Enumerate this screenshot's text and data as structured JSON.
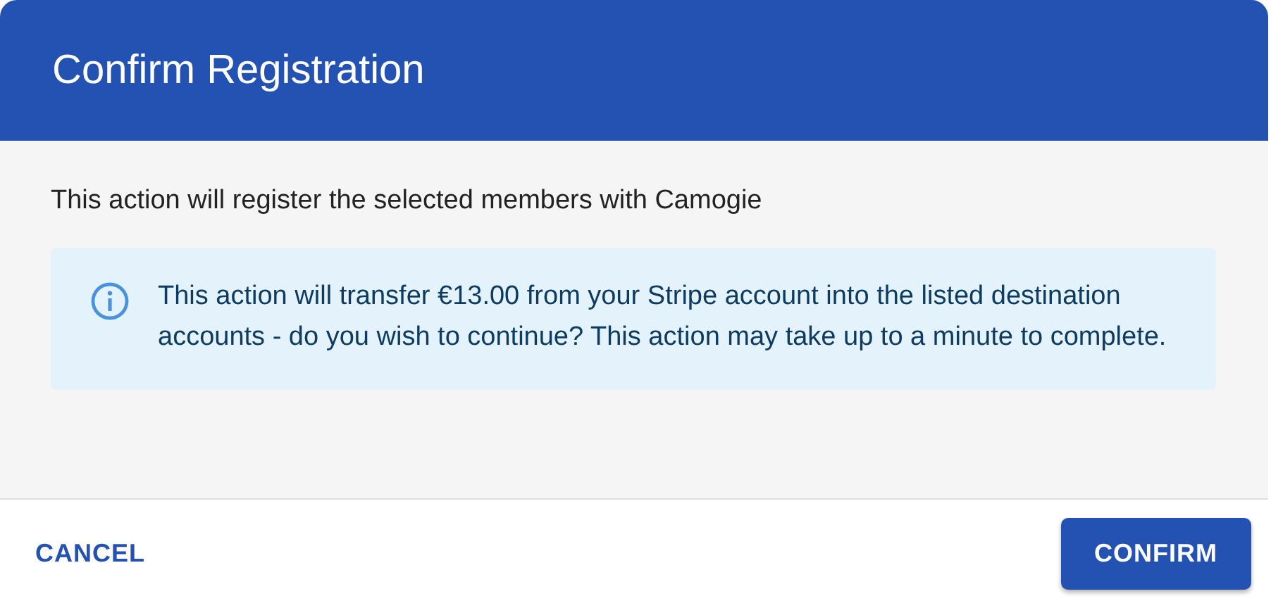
{
  "dialog": {
    "title": "Confirm Registration",
    "message": "This action will register the selected members with Camogie",
    "alert": {
      "kind": "info",
      "text": "This action will transfer €13.00 from your Stripe account into the listed destination accounts - do you wish to continue? This action may take up to a minute to complete."
    },
    "buttons": [
      {
        "label": "CANCEL",
        "kind": "text"
      },
      {
        "label": "CONFIRM",
        "kind": "contained"
      }
    ]
  }
}
